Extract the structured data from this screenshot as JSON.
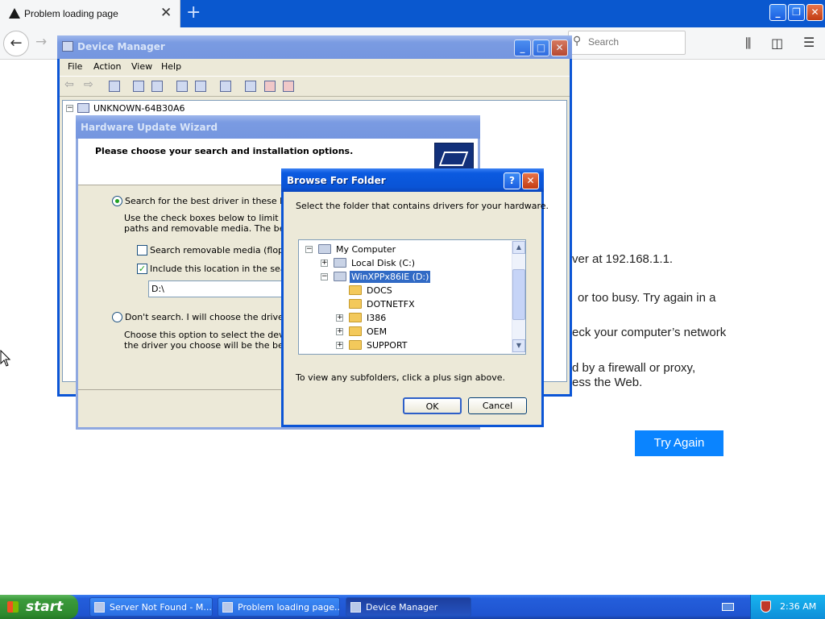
{
  "firefox": {
    "tab_title": "Problem loading page",
    "search_placeholder": "Search",
    "error_lines": [
      "ver at 192.168.1.1.",
      "or too busy. Try again in a",
      "eck your computer’s network",
      "d by a firewall or proxy,",
      "ess the Web."
    ],
    "try_again_label": "Try Again"
  },
  "device_manager": {
    "title": "Device Manager",
    "menu": [
      "File",
      "Action",
      "View",
      "Help"
    ],
    "tree_root": "UNKNOWN-64B30A6"
  },
  "wizard": {
    "title": "Hardware Update Wizard",
    "heading": "Please choose your search and installation options.",
    "option_search": "Search for the best driver in these locatio",
    "option_search_desc_1": "Use the check boxes below to limit or exp",
    "option_search_desc_2": "paths and removable media. The best driv",
    "chk_removable": "Search removable media (floppy, C",
    "chk_location": "Include this location in the search:",
    "location_value": "D:\\",
    "option_dont": "Don't search. I will choose the driver to in",
    "option_dont_desc_1": "Choose this option to select the device dr",
    "option_dont_desc_2": "the driver you choose will be the best mat"
  },
  "browse": {
    "title": "Browse For Folder",
    "instruction": "Select the folder that contains drivers for your hardware.",
    "tree": [
      {
        "label": "My Computer",
        "level": 0,
        "expander": "−"
      },
      {
        "label": "Local Disk (C:)",
        "level": 1,
        "expander": "+"
      },
      {
        "label": "WinXPPx86IE (D:)",
        "level": 1,
        "expander": "−",
        "selected": true
      },
      {
        "label": "DOCS",
        "level": 2,
        "expander": ""
      },
      {
        "label": "DOTNETFX",
        "level": 2,
        "expander": ""
      },
      {
        "label": "I386",
        "level": 2,
        "expander": "+"
      },
      {
        "label": "OEM",
        "level": 2,
        "expander": "+"
      },
      {
        "label": "SUPPORT",
        "level": 2,
        "expander": "+"
      }
    ],
    "hint": "To view any subfolders, click a plus sign above.",
    "ok_label": "OK",
    "cancel_label": "Cancel"
  },
  "taskbar": {
    "start_label": "start",
    "tasks": [
      "Server Not Found - M...",
      "Problem loading page...",
      "Device Manager"
    ],
    "clock": "2:36 AM"
  },
  "colors": {
    "xp_blue": "#0a54d6",
    "firefox_accent": "#0a84ff",
    "selection": "#316ac5"
  }
}
